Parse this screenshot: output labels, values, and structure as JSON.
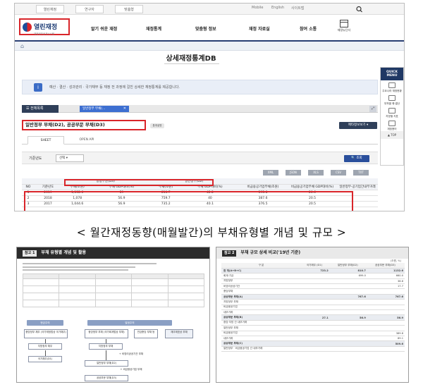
{
  "utility": {
    "tabs": [
      "열린재정",
      "연구자",
      "맞춤형"
    ],
    "links": [
      "Mobile",
      "English",
      "사이트맵"
    ]
  },
  "header": {
    "logo_title": "열린재정",
    "logo_subtitle": "재정정보공개시스템",
    "nav": [
      "알기 쉬운 재정",
      "재정통계",
      "맞춤형 정보",
      "재정 자료실",
      "참여 소통"
    ],
    "guide_label": "재정뉴딘더"
  },
  "page": {
    "title": "상세재정통계DB",
    "info_text": "예산 · 결산 · 성과관리 · 국가채무 등 재정 전 과정에 걸친 상세한 재정통계를 제공합니다.",
    "tab_all": "전체목록",
    "tab_doc": "일반정부 부채(...",
    "stat_title": "일반정부 부채(D2), 공공부문 부채(D3)",
    "stat_badge": "통계설명",
    "meta_button": "메타정보보기",
    "subtabs": [
      "SHEET",
      "OPEN API"
    ],
    "filter_label": "기준년도",
    "filter_value": "선택",
    "query_button": "조회",
    "formats": [
      "XML",
      "JSON",
      "XLS",
      "CSV",
      "TXT"
    ]
  },
  "grid": {
    "group_headers": [
      "공공부문(D3)",
      "일반정부(D2)"
    ],
    "columns": [
      "NO",
      "기준년도",
      "부채(조원)",
      "부채 GDP대비(%)",
      "부채(조원)",
      "부채 GDP대비(%)",
      "비금융공기업부채(조원)",
      "비금융공기업부채 GDP대비(%)",
      "일반정부-공기업간내부거래"
    ],
    "rows": [
      [
        "1",
        "2019",
        "1,132.6",
        "59",
        "810.7",
        "42.2",
        "395.8",
        "20.6",
        ""
      ],
      [
        "2",
        "2018",
        "1,078",
        "56.9",
        "759.7",
        "40",
        "387.6",
        "20.5",
        ""
      ],
      [
        "3",
        "2017",
        "1,044.6",
        "56.9",
        "735.2",
        "40.1",
        "376.5",
        "20.5",
        ""
      ]
    ]
  },
  "quick_menu": {
    "head": "QUICK MENU",
    "items": [
      "주요나라 재정현황",
      "부처별 예·결산",
      "지방별 지표",
      "재정용어"
    ],
    "top": "TOP"
  },
  "caption": "< 월간재정동향(매월발간)의 부채유형별 개념 및 규모 >",
  "doc_left": {
    "chip": "참고 1",
    "title": "부채 유형별 개념 및 활용",
    "diagram": {
      "heads": [
        "현금주의",
        "발생주의"
      ],
      "left_boxes": [
        "중앙정부 채무\n(국가재정법상 국가채무)",
        "지방정부 채무",
        "국가채무(D1)"
      ],
      "mid_boxes": [
        "중앙정부 부채\n(국가회계법상 부채)",
        "지방정부 부채"
      ],
      "side_boxes": [
        "연금충당\n부채 등",
        "재무제표상\n부채"
      ],
      "chain": [
        "+ 비영리공공기관 부채",
        "일반정부 부채(D2)",
        "+ 비금융공기업 부채",
        "공공부문 부채(D3)"
      ]
    }
  },
  "doc_right": {
    "chip": "참고 2",
    "title": "부채 규모 상세 비교('19년 기준)",
    "unit": "(조원, %)",
    "headers": [
      "구 분",
      "국가채무\n(D1)",
      "일반정부\n부채(D2)",
      "공공부문\n부채(D3)"
    ],
    "rows": [
      [
        "합 계(A+B+C)",
        "723.2",
        "810.7",
        "1132.6"
      ],
      [
        "회계·기금",
        "",
        "699.0",
        "660.0"
      ],
      [
        "지방정부",
        "",
        "",
        "38.8"
      ],
      [
        "비영리공공기관",
        "",
        "",
        "17.7"
      ],
      [
        "충당부채",
        "",
        "",
        ""
      ],
      [
        "공공부문 부채(A)",
        "",
        "767.6",
        "767.6"
      ],
      [
        "지방정부 부채",
        "",
        "",
        ""
      ],
      [
        "비금융공기업",
        "",
        "",
        ""
      ],
      [
        "내부거래",
        "",
        "",
        ""
      ],
      [
        "공공부문 부채(B)",
        "27.1",
        "56.9",
        "56.9"
      ],
      [
        "중앙·지방 간 내부거래",
        "",
        "",
        ""
      ],
      [
        "일반정부 부채",
        "",
        "",
        ""
      ],
      [
        "비금융공기업",
        "",
        "",
        "389.8"
      ],
      [
        "내부거래",
        "",
        "",
        "89.1"
      ],
      [
        "공공부문 부채(C)",
        "",
        "",
        "509.6"
      ],
      [
        "일반정부 · 비금융공기업 간 내부거래",
        "",
        "",
        ""
      ]
    ]
  }
}
